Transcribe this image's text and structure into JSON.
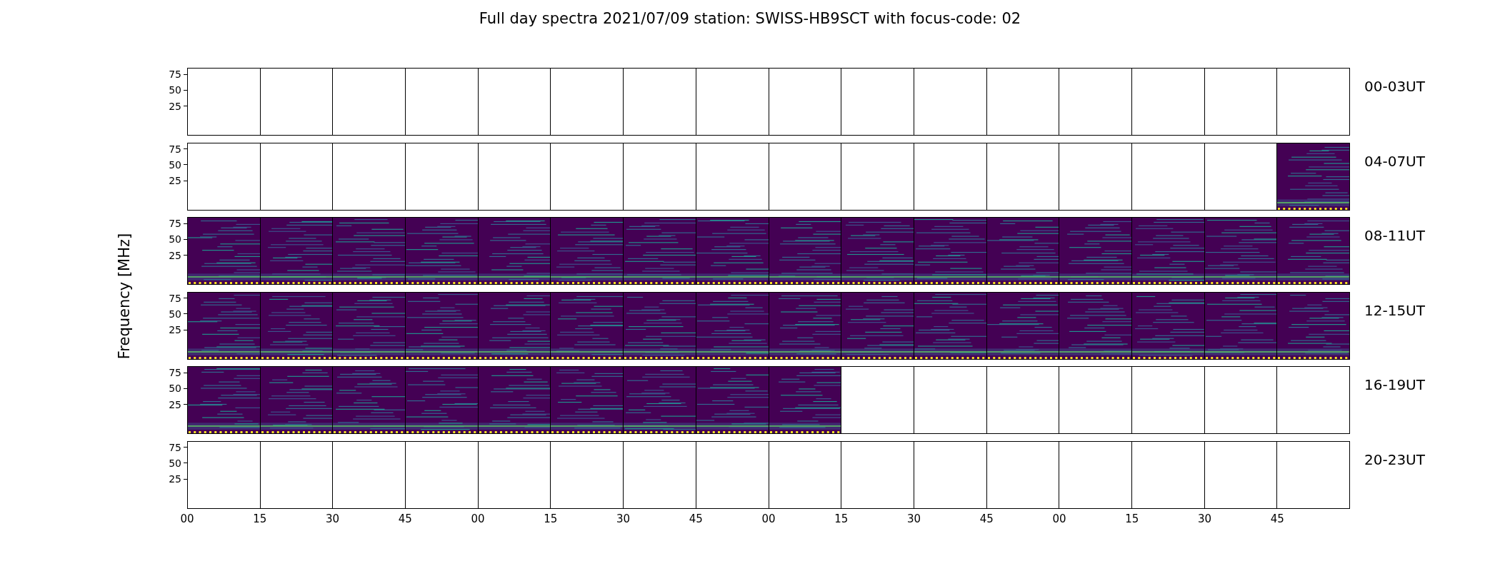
{
  "title": "Full day spectra 2021/07/09 station: SWISS-HB9SCT with focus-code: 02",
  "ylabel": "Frequency [MHz]",
  "xticks": [
    "00",
    "15",
    "30",
    "45",
    "00",
    "15",
    "30",
    "45",
    "00",
    "15",
    "30",
    "45",
    "00",
    "15",
    "30",
    "45"
  ],
  "rows": [
    {
      "label": "00-03UT",
      "yticks": [
        "75",
        "50",
        "25"
      ],
      "panels": [
        {
          "kind": "empty"
        },
        {
          "kind": "empty"
        },
        {
          "kind": "empty"
        },
        {
          "kind": "empty"
        },
        {
          "kind": "empty"
        },
        {
          "kind": "empty"
        },
        {
          "kind": "empty"
        },
        {
          "kind": "empty"
        },
        {
          "kind": "empty"
        },
        {
          "kind": "empty"
        },
        {
          "kind": "empty"
        },
        {
          "kind": "empty"
        },
        {
          "kind": "empty"
        },
        {
          "kind": "empty"
        },
        {
          "kind": "empty"
        },
        {
          "kind": "empty"
        }
      ]
    },
    {
      "label": "04-07UT",
      "yticks": [
        "75",
        "50",
        "25"
      ],
      "panels": [
        {
          "kind": "empty"
        },
        {
          "kind": "empty"
        },
        {
          "kind": "empty"
        },
        {
          "kind": "empty"
        },
        {
          "kind": "empty"
        },
        {
          "kind": "empty"
        },
        {
          "kind": "empty"
        },
        {
          "kind": "empty"
        },
        {
          "kind": "empty"
        },
        {
          "kind": "empty"
        },
        {
          "kind": "empty"
        },
        {
          "kind": "empty"
        },
        {
          "kind": "empty"
        },
        {
          "kind": "empty"
        },
        {
          "kind": "empty"
        },
        {
          "kind": "spectrum"
        }
      ]
    },
    {
      "label": "08-11UT",
      "yticks": [
        "75",
        "50",
        "25"
      ],
      "panels": [
        {
          "kind": "spectrum"
        },
        {
          "kind": "spectrum"
        },
        {
          "kind": "spectrum"
        },
        {
          "kind": "spectrum"
        },
        {
          "kind": "spectrum"
        },
        {
          "kind": "spectrum"
        },
        {
          "kind": "spectrum"
        },
        {
          "kind": "spectrum"
        },
        {
          "kind": "spectrum"
        },
        {
          "kind": "spectrum"
        },
        {
          "kind": "spectrum"
        },
        {
          "kind": "spectrum"
        },
        {
          "kind": "spectrum"
        },
        {
          "kind": "spectrum"
        },
        {
          "kind": "spectrum"
        },
        {
          "kind": "spectrum"
        }
      ]
    },
    {
      "label": "12-15UT",
      "yticks": [
        "75",
        "50",
        "25"
      ],
      "panels": [
        {
          "kind": "spectrum"
        },
        {
          "kind": "spectrum"
        },
        {
          "kind": "spectrum"
        },
        {
          "kind": "spectrum"
        },
        {
          "kind": "spectrum"
        },
        {
          "kind": "spectrum"
        },
        {
          "kind": "spectrum"
        },
        {
          "kind": "spectrum"
        },
        {
          "kind": "spectrum"
        },
        {
          "kind": "spectrum"
        },
        {
          "kind": "spectrum"
        },
        {
          "kind": "spectrum"
        },
        {
          "kind": "spectrum"
        },
        {
          "kind": "spectrum"
        },
        {
          "kind": "spectrum"
        },
        {
          "kind": "spectrum"
        }
      ]
    },
    {
      "label": "16-19UT",
      "yticks": [
        "75",
        "50",
        "25"
      ],
      "panels": [
        {
          "kind": "spectrum"
        },
        {
          "kind": "spectrum"
        },
        {
          "kind": "spectrum"
        },
        {
          "kind": "spectrum"
        },
        {
          "kind": "spectrum"
        },
        {
          "kind": "spectrum"
        },
        {
          "kind": "spectrum"
        },
        {
          "kind": "spectrum"
        },
        {
          "kind": "spectrum"
        },
        {
          "kind": "empty"
        },
        {
          "kind": "empty"
        },
        {
          "kind": "empty"
        },
        {
          "kind": "empty"
        },
        {
          "kind": "empty"
        },
        {
          "kind": "empty"
        },
        {
          "kind": "empty"
        }
      ]
    },
    {
      "label": "20-23UT",
      "yticks": [
        "75",
        "50",
        "25"
      ],
      "panels": [
        {
          "kind": "empty"
        },
        {
          "kind": "empty"
        },
        {
          "kind": "empty"
        },
        {
          "kind": "empty"
        },
        {
          "kind": "empty"
        },
        {
          "kind": "empty"
        },
        {
          "kind": "empty"
        },
        {
          "kind": "empty"
        },
        {
          "kind": "empty"
        },
        {
          "kind": "empty"
        },
        {
          "kind": "empty"
        },
        {
          "kind": "empty"
        },
        {
          "kind": "empty"
        },
        {
          "kind": "empty"
        },
        {
          "kind": "empty"
        },
        {
          "kind": "empty"
        }
      ]
    }
  ]
}
